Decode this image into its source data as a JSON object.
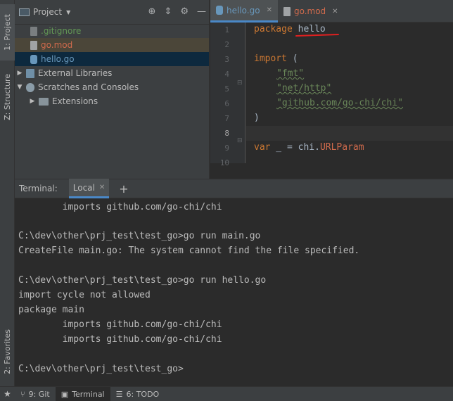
{
  "left_strip": {
    "project": "1: Project",
    "structure": "Z: Structure",
    "favorites": "2: Favorites"
  },
  "project_panel": {
    "title": "Project",
    "items": [
      {
        "label": ".gitignore",
        "color": "#629755",
        "icon": "gitignore-icon"
      },
      {
        "label": "go.mod",
        "color": "#cf6a4c",
        "icon": "go-mod-file-icon"
      },
      {
        "label": "hello.go",
        "color": "#6897bb",
        "icon": "go-file-icon"
      },
      {
        "label": "External Libraries",
        "color": "#bbbbbb",
        "icon": "library-icon"
      },
      {
        "label": "Scratches and Consoles",
        "color": "#bbbbbb",
        "icon": "scratches-icon"
      },
      {
        "label": "Extensions",
        "color": "#bbbbbb",
        "icon": "folder-icon"
      }
    ]
  },
  "editor": {
    "tabs": [
      {
        "label": "hello.go",
        "color": "#6897bb",
        "icon": "go-file-icon"
      },
      {
        "label": "go.mod",
        "color": "#cf6a4c",
        "icon": "go-mod-file-icon"
      }
    ],
    "line_numbers": [
      "1",
      "2",
      "3",
      "4",
      "5",
      "6",
      "7",
      "8",
      "9",
      "10"
    ],
    "code": {
      "l1_kw": "package",
      "l1_name": "hello",
      "l3_kw": "import",
      "l3_paren": " (",
      "l4": "\"fmt\"",
      "l5": "\"net/http\"",
      "l6": "\"github.com/go-chi/chi\"",
      "l7": ")",
      "l9_kw": "var",
      "l9_mid": " _ = chi.",
      "l9_fn": "URLParam"
    }
  },
  "terminal": {
    "label": "Terminal:",
    "tab": "Local",
    "lines": [
      "        imports github.com/go-chi/chi",
      "",
      "C:\\dev\\other\\prj_test\\test_go>go run main.go",
      "CreateFile main.go: The system cannot find the file specified.",
      "",
      "C:\\dev\\other\\prj_test\\test_go>go run hello.go",
      "import cycle not allowed",
      "package main",
      "        imports github.com/go-chi/chi",
      "        imports github.com/go-chi/chi",
      "",
      "C:\\dev\\other\\prj_test\\test_go>"
    ]
  },
  "bottom_bar": {
    "git": "9: Git",
    "terminal": "Terminal",
    "todo": "6: TODO"
  },
  "colors": {
    "accent": "#4a88c7",
    "error_underline": "#e02020"
  }
}
